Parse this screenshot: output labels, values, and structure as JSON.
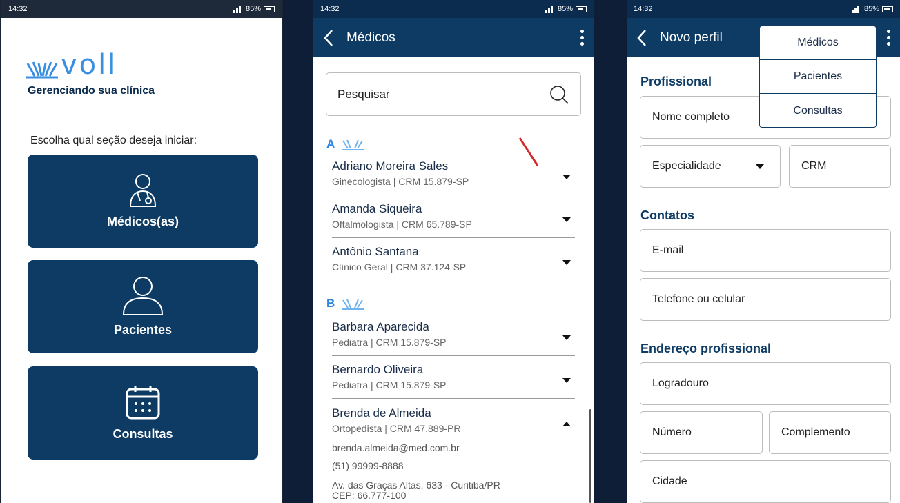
{
  "status": {
    "time": "14:32",
    "battery": "85%"
  },
  "home": {
    "logo": "voll",
    "tagline": "Gerenciando sua clínica",
    "prompt": "Escolha qual seção deseja iniciar:",
    "buttons": [
      {
        "label": "Médicos(as)",
        "icon": "doctor-icon"
      },
      {
        "label": "Pacientes",
        "icon": "patient-icon"
      },
      {
        "label": "Consultas",
        "icon": "calendar-icon"
      }
    ]
  },
  "doctors": {
    "title": "Médicos",
    "search_placeholder": "Pesquisar",
    "groups": [
      {
        "letter": "A",
        "items": [
          {
            "name": "Adriano Moreira Sales",
            "sub": "Ginecologista | CRM 15.879-SP"
          },
          {
            "name": "Amanda Siqueira",
            "sub": "Oftalmologista | CRM 65.789-SP"
          },
          {
            "name": "Antônio Santana",
            "sub": "Clínico Geral | CRM 37.124-SP"
          }
        ]
      },
      {
        "letter": "B",
        "items": [
          {
            "name": "Barbara Aparecida",
            "sub": "Pediatra | CRM 15.879-SP"
          },
          {
            "name": "Bernardo Oliveira",
            "sub": "Pediatra | CRM 15.879-SP"
          },
          {
            "name": "Brenda de Almeida",
            "sub": "Ortopedista | CRM 47.889-PR"
          }
        ]
      }
    ],
    "expanded": {
      "email": "brenda.almeida@med.com.br",
      "phone": "(51) 99999-8888",
      "address1": "Av. das Graças Altas, 633 - Curitiba/PR",
      "address2": "CEP: 66.777-100"
    }
  },
  "profile": {
    "title": "Novo perfil",
    "menu": [
      "Médicos",
      "Pacientes",
      "Consultas"
    ],
    "sec_professional": "Profissional",
    "full_name": "Nome completo",
    "specialty": "Especialidade",
    "crm": "CRM",
    "sec_contacts": "Contatos",
    "email": "E-mail",
    "phone": "Telefone ou celular",
    "sec_address": "Endereço profissional",
    "street": "Logradouro",
    "number": "Número",
    "complement": "Complemento",
    "city": "Cidade"
  },
  "colors": {
    "primary": "#0d3b63",
    "accent": "#2a86e0",
    "background": "#0f1e37"
  }
}
